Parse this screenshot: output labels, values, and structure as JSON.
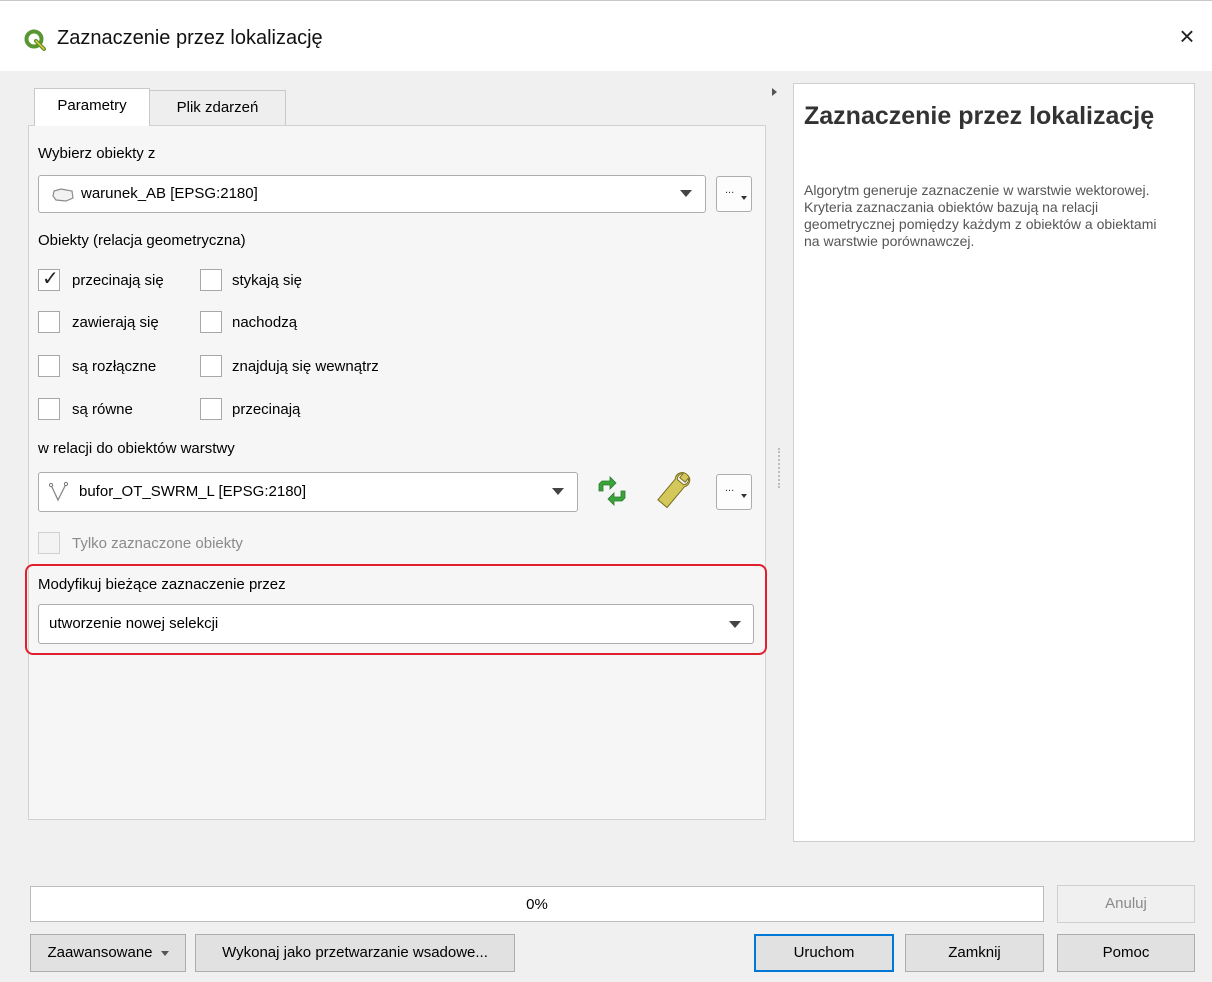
{
  "window": {
    "title": "Zaznaczenie przez lokalizację",
    "close_glyph": "×",
    "app_icon": "qgis-icon"
  },
  "tabs": [
    {
      "label": "Parametry",
      "active": true
    },
    {
      "label": "Plik zdarzeń",
      "active": false
    }
  ],
  "params": {
    "select_from_label": "Wybierz obiekty z",
    "select_from_value": "warunek_AB [EPSG:2180]",
    "relation_label": "Obiekty (relacja geometryczna)",
    "predicates": [
      {
        "label": "przecinają się",
        "checked": true
      },
      {
        "label": "stykają się",
        "checked": false
      },
      {
        "label": "zawierają się",
        "checked": false
      },
      {
        "label": "nachodzą",
        "checked": false
      },
      {
        "label": "są rozłączne",
        "checked": false
      },
      {
        "label": "znajdują się wewnątrz",
        "checked": false
      },
      {
        "label": "są równe",
        "checked": false
      },
      {
        "label": "przecinają",
        "checked": false
      }
    ],
    "compare_label": "w relacji do obiektów warstwy",
    "compare_value": "bufor_OT_SWRM_L [EPSG:2180]",
    "selected_only_label": "Tylko zaznaczone obiekty",
    "modify_label": "Modyfikuj bieżące zaznaczenie przez",
    "modify_value": "utworzenie nowej selekcji",
    "dots_glyph": "...",
    "check_glyph": "✓"
  },
  "help": {
    "title": "Zaznaczenie przez lokalizację",
    "text": "Algorytm generuje zaznaczenie w warstwie wektorowej. Kryteria zaznaczania obiektów bazują na relacji geometrycznej pomiędzy każdym z obiektów a obiektami na warstwie porównawczej."
  },
  "progress": {
    "value": 0,
    "label": "0%"
  },
  "buttons": {
    "cancel": "Anuluj",
    "advanced": "Zaawansowane",
    "batch": "Wykonaj jako przetwarzanie wsadowe...",
    "run": "Uruchom",
    "close": "Zamknij",
    "help": "Pomoc"
  },
  "colors": {
    "highlight": "#e0202c",
    "default_button_border": "#0078d7",
    "qgis_green": "#589632",
    "refresh_icon_green": "#3aa33a"
  }
}
